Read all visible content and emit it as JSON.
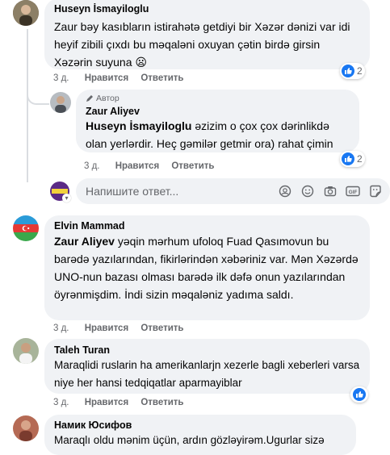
{
  "comments": [
    {
      "author": "Huseyn İsmayiloglu",
      "text": "Zaur bəy kasıbların istirahətə getdiyi bir Xəzər dənizi var idi heyif zibili çıxdı bu məqaləni oxuyan çətin birdə girsin Xəzərin suyuna",
      "emoji": "😦",
      "time": "3 д.",
      "like_label": "Нравится",
      "reply_label": "Ответить",
      "reactions": "2"
    },
    {
      "badge": "Автор",
      "author": "Zaur Aliyev",
      "mention": "Huseyn İsmayiloglu",
      "text": " əzizim o çox çox dərinlikdə olan yerlərdir. Heç gəmilər getmir ora) rahat çimin",
      "time": "3 д.",
      "like_label": "Нравится",
      "reply_label": "Ответить",
      "reactions": "2"
    },
    {
      "author": "Elvin Mammad",
      "mention": "Zaur Aliyev",
      "text": " yəqin mərhum ufoloq Fuad Qasımovun bu barədə yazılarından, fikirlərindən xəbəriniz var. Mən Xəzərdə UNO-nun bazası olması barədə ilk dəfə onun yazılarından öyrənmişdim. İndi sizin məqaləniz yadıma saldı.",
      "time": "3 д.",
      "like_label": "Нравится",
      "reply_label": "Ответить"
    },
    {
      "author": "Taleh Turan",
      "text": "Maraqlidi ruslarin ha amerikanlarjn xezerle bagli xeberleri varsa niye her hansi tedqiqatlar aparmayiblar",
      "time": "3 д.",
      "like_label": "Нравится",
      "reply_label": "Ответить"
    },
    {
      "author": "Намик Юсифов",
      "text": "Maraqlı oldu mənim üçün, ardın gözləyirəm.Ugurlar sizə"
    }
  ],
  "reply_box": {
    "placeholder": "Напишите ответ..."
  },
  "colors": {
    "bubble": "#f0f2f5",
    "meta": "#65676b",
    "like_blue": "#1877f2"
  }
}
